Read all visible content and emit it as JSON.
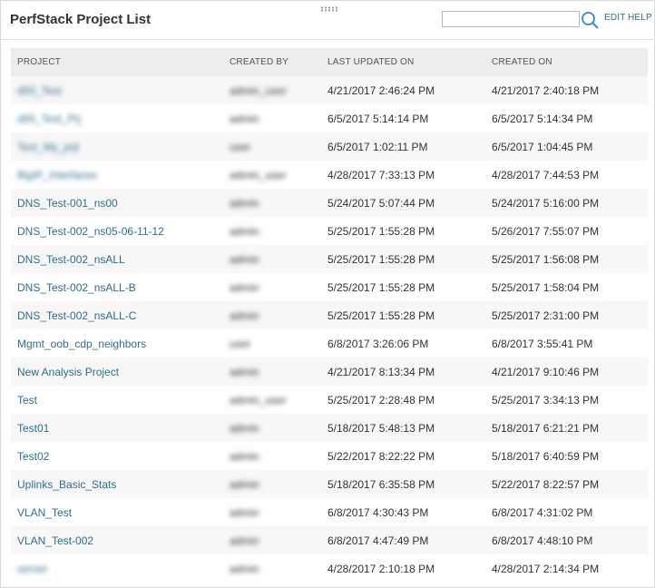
{
  "header": {
    "title": "PerfStack Project List",
    "search_value": "",
    "edit_label": "EDIT",
    "help_label": "HELP"
  },
  "table": {
    "columns": [
      "PROJECT",
      "CREATED BY",
      "LAST UPDATED ON",
      "CREATED ON"
    ],
    "rows": [
      {
        "project": "d00_Test",
        "created_by": "admin_user",
        "updated": "4/21/2017 2:46:24 PM",
        "created": "4/21/2017 2:40:18 PM",
        "blur_project": true
      },
      {
        "project": "d00_Test_Prj",
        "created_by": "admin",
        "updated": "6/5/2017 5:14:14 PM",
        "created": "6/5/2017 5:14:34 PM",
        "blur_project": true
      },
      {
        "project": "Test_My_prjt",
        "created_by": "user",
        "updated": "6/5/2017 1:02:11 PM",
        "created": "6/5/2017 1:04:45 PM",
        "blur_project": true
      },
      {
        "project": "BigIP_Interfaces",
        "created_by": "admin_user",
        "updated": "4/28/2017 7:33:13 PM",
        "created": "4/28/2017 7:44:53 PM",
        "blur_project": true
      },
      {
        "project": "DNS_Test-001_ns00",
        "created_by": "admin",
        "updated": "5/24/2017 5:07:44 PM",
        "created": "5/24/2017 5:16:00 PM",
        "blur_project": false
      },
      {
        "project": "DNS_Test-002_ns05-06-11-12",
        "created_by": "admin",
        "updated": "5/25/2017 1:55:28 PM",
        "created": "5/26/2017 7:55:07 PM",
        "blur_project": false
      },
      {
        "project": "DNS_Test-002_nsALL",
        "created_by": "admin",
        "updated": "5/25/2017 1:55:28 PM",
        "created": "5/25/2017 1:56:08 PM",
        "blur_project": false
      },
      {
        "project": "DNS_Test-002_nsALL-B",
        "created_by": "admin",
        "updated": "5/25/2017 1:55:28 PM",
        "created": "5/25/2017 1:58:04 PM",
        "blur_project": false
      },
      {
        "project": "DNS_Test-002_nsALL-C",
        "created_by": "admin",
        "updated": "5/25/2017 1:55:28 PM",
        "created": "5/25/2017 2:31:00 PM",
        "blur_project": false
      },
      {
        "project": "Mgmt_oob_cdp_neighbors",
        "created_by": "user",
        "updated": "6/8/2017 3:26:06 PM",
        "created": "6/8/2017 3:55:41 PM",
        "blur_project": false
      },
      {
        "project": "New Analysis Project",
        "created_by": "admin",
        "updated": "4/21/2017 8:13:34 PM",
        "created": "4/21/2017 9:10:46 PM",
        "blur_project": false
      },
      {
        "project": "Test",
        "created_by": "admin_user",
        "updated": "5/25/2017 2:28:48 PM",
        "created": "5/25/2017 3:34:13 PM",
        "blur_project": false
      },
      {
        "project": "Test01",
        "created_by": "admin",
        "updated": "5/18/2017 5:48:13 PM",
        "created": "5/18/2017 6:21:21 PM",
        "blur_project": false
      },
      {
        "project": "Test02",
        "created_by": "admin",
        "updated": "5/22/2017 8:22:22 PM",
        "created": "5/18/2017 6:40:59 PM",
        "blur_project": false
      },
      {
        "project": "Uplinks_Basic_Stats",
        "created_by": "admin",
        "updated": "5/18/2017 6:35:58 PM",
        "created": "5/22/2017 8:22:57 PM",
        "blur_project": false
      },
      {
        "project": "VLAN_Test",
        "created_by": "admin",
        "updated": "6/8/2017 4:30:43 PM",
        "created": "6/8/2017 4:31:02 PM",
        "blur_project": false
      },
      {
        "project": "VLAN_Test-002",
        "created_by": "admin",
        "updated": "6/8/2017 4:47:49 PM",
        "created": "6/8/2017 4:48:10 PM",
        "blur_project": false
      },
      {
        "project": "server",
        "created_by": "admin",
        "updated": "4/28/2017 2:10:18 PM",
        "created": "4/28/2017 2:14:34 PM",
        "blur_project": true
      }
    ]
  },
  "colors": {
    "link": "#2f6e91",
    "header_bg": "#ececec",
    "stripe_bg": "#f7f7f7"
  },
  "icons": [
    "drag-handle-icon",
    "search-icon"
  ]
}
